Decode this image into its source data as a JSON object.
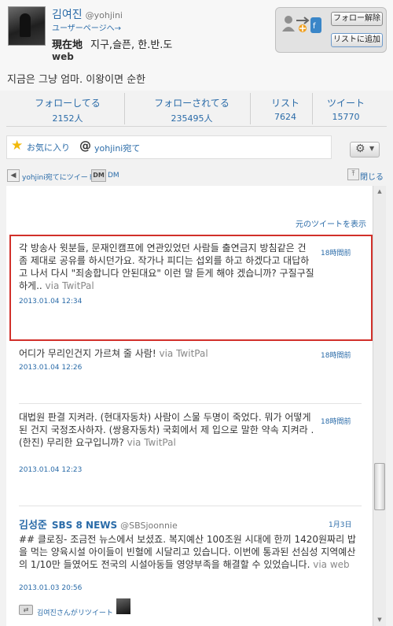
{
  "profile": {
    "name": "김여진",
    "handle": "@yohjini",
    "user_page_link": "ユーザーページへ→",
    "location_label": "現在地",
    "location": "지구,슬픈, 한.반.도",
    "web": "web",
    "bio": "지금은 그냥 엄마. 이왕이면 순한"
  },
  "actions": {
    "unfollow": "フォロー解除",
    "add_to_list": "リストに追加"
  },
  "stats": [
    {
      "label": "フォローしてる",
      "value": "2152人"
    },
    {
      "label": "フォローされてる",
      "value": "235495人"
    },
    {
      "label": "リスト",
      "value": "7624"
    },
    {
      "label": "ツイート",
      "value": "15770"
    }
  ],
  "filters": {
    "favorites": "お気に入り",
    "at_symbol": "@",
    "replies": "yohjini宛て"
  },
  "toolbar": {
    "reply_to": "yohjini宛てにツイート",
    "dm_icon": "DM",
    "dm": "DM",
    "close": "閉じる"
  },
  "timeline": {
    "show_original": "元のツイートを表示",
    "tweets": [
      {
        "text": "각 방송사 윗분들, 문재인캠프에 연관있었던 사람들 출연금지 방침같은 건 좀 제대로 공유를 하시던가요. 작가나 피디는 섭외를 하고 하겠다고 대답하고 나서 다시 \"죄송합니다 안된대요\" 이런 말 듣게 해야 겠습니까? 구질구질하게..",
        "via": "via TwitPal",
        "ago": "18時間前",
        "date": "2013.01.04 12:34"
      },
      {
        "text": "어디가 무리인건지 가르쳐 줄 사람!",
        "via": "via TwitPal",
        "ago": "18時間前",
        "date": "2013.01.04 12:26"
      },
      {
        "text": "대법원 판결 지켜라. (현대자동차) 사람이 스물 두명이 죽었다. 뭐가 어떻게 된 건지 국정조사하자. (쌍용자동차) 국회에서 제 입으로 말한 약속 지켜라 . (한진) 무리한 요구입니까?",
        "via": "via TwitPal",
        "ago": "18時間前",
        "date": "2013.01.04 12:23"
      },
      {
        "author": "김성준",
        "author_en": "SBS 8 NEWS",
        "handle": "@SBSjoonnie",
        "text": "## 클로징- 조금전 뉴스에서 보셨죠. 복지예산 100조원 시대에 한끼 1420원짜리 밥을 먹는 양육시설 아이들이 빈혈에 시달리고 있습니다. 이번에 통과된 선심성 지역예산의 1/10만 들였어도 전국의 시설아동들 영양부족을 해결할 수 있었습니다.",
        "via": "via web",
        "ago": "1月3日",
        "date": "2013.01.03 20:56",
        "retweeted_by": "김여진さんがリツイート"
      }
    ]
  }
}
